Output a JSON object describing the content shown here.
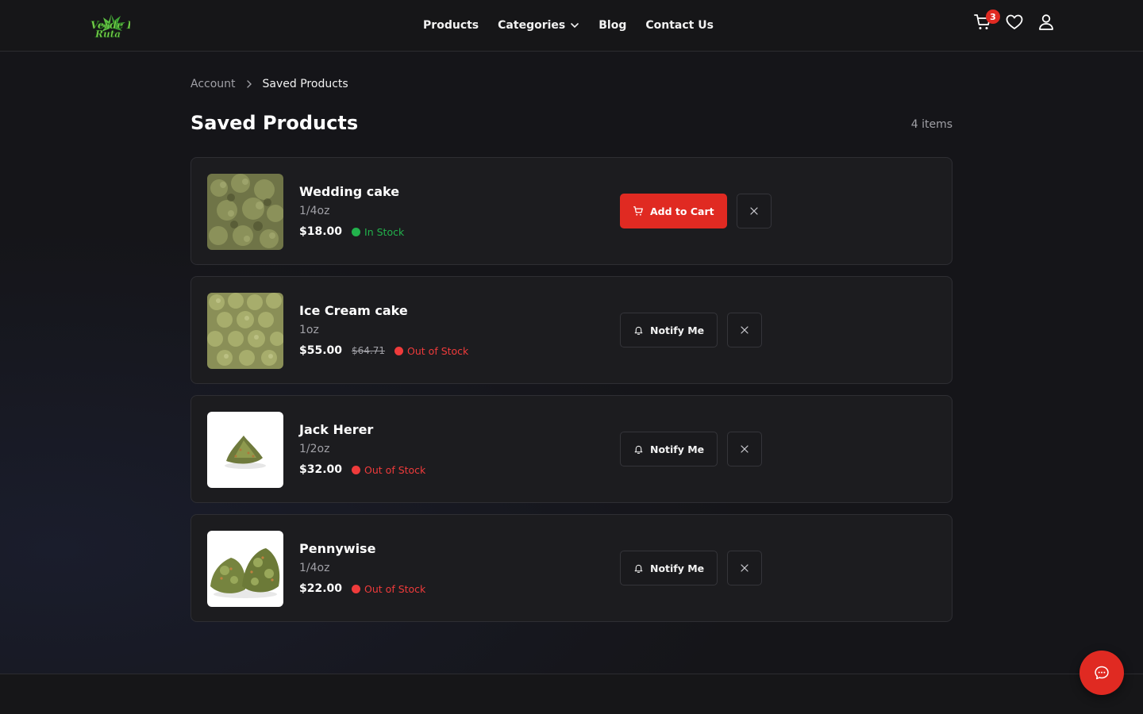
{
  "header": {
    "logo_text": "Verde Ruta",
    "nav": [
      "Products",
      "Categories",
      "Blog",
      "Contact Us"
    ],
    "cart_count": "3"
  },
  "breadcrumb": {
    "parent": "Account",
    "current": "Saved Products"
  },
  "page": {
    "title": "Saved Products",
    "count": "4 items"
  },
  "products": [
    {
      "name": "Wedding cake",
      "size": "1/4oz",
      "price": "$18.00",
      "old_price": "",
      "stock": "In Stock",
      "action": "Add to Cart"
    },
    {
      "name": "Ice Cream cake",
      "size": "1oz",
      "price": "$55.00",
      "old_price": "$64.71",
      "stock": "Out of Stock",
      "action": "Notify Me"
    },
    {
      "name": "Jack Herer",
      "size": "1/2oz",
      "price": "$32.00",
      "old_price": "",
      "stock": "Out of Stock",
      "action": "Notify Me"
    },
    {
      "name": "Pennywise",
      "size": "1/4oz",
      "price": "$22.00",
      "old_price": "",
      "stock": "Out of Stock",
      "action": "Notify Me"
    }
  ],
  "colors": {
    "accent": "#e02a22",
    "in_stock": "#22b24c",
    "out_of_stock": "#ef3b3b",
    "background": "#151519"
  }
}
